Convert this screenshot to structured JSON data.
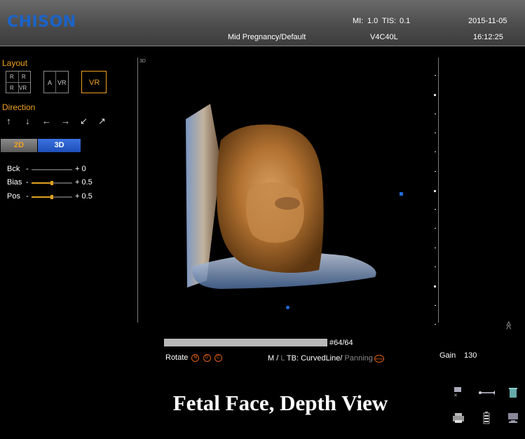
{
  "header": {
    "brand": "CHISON",
    "mi_label": "MI:",
    "mi_value": "1.0",
    "tis_label": "TIS:",
    "tis_value": "0.1",
    "date": "2015-11-05",
    "preset": "Mid Pregnancy/Default",
    "probe": "V4C40L",
    "time": "16:12:25"
  },
  "left_panel": {
    "layout_title": "Layout",
    "layout_quad": [
      "R",
      "R",
      "R",
      "VR"
    ],
    "layout_dual": [
      "A",
      "VR"
    ],
    "layout_single": "VR",
    "direction_title": "Direction",
    "direction_arrows": [
      "↑",
      "↓",
      "←",
      "→",
      "↙",
      "↗"
    ],
    "mode_2d": "2D",
    "mode_3d": "3D",
    "params": [
      {
        "name": "Bck",
        "value": "+ 0",
        "level": 0.0
      },
      {
        "name": "Bias",
        "value": "+ 0.5",
        "level": 0.5
      },
      {
        "name": "Pos",
        "value": "+ 0.5",
        "level": 0.5
      }
    ]
  },
  "view": {
    "label": "3D"
  },
  "bottom": {
    "frame": "#64/64",
    "frame_progress": 1.0,
    "rotate_label": "Rotate",
    "rotate_icons": [
      "M",
      "D",
      "C"
    ],
    "mode_line_m": "M",
    "mode_line_sep": "/",
    "mode_line_l": "L",
    "mode_line_tb": "TB: CurvedLine",
    "mode_line_panning": "Panning",
    "menu_icon": "MENU",
    "gain_label": "Gain",
    "gain_value": "130",
    "scroll_arrows": "≫",
    "caption": "Fetal Face, Depth View"
  },
  "icons": {
    "top_row": [
      "image-stack-icon",
      "usb-icon",
      "trash-icon"
    ],
    "bottom_row": [
      "printer-icon",
      "battery-icon",
      "computer-icon"
    ]
  },
  "colors": {
    "accent_orange": "#f0a020",
    "brand_blue": "#1b63c9",
    "mode_3d_active": "#1e56c8"
  }
}
